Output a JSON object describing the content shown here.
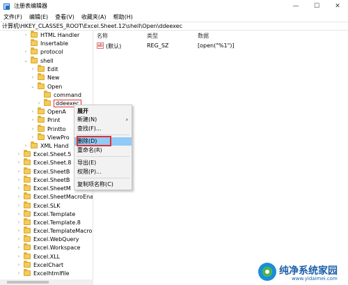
{
  "window": {
    "title": "注册表编辑器",
    "minimize": "—",
    "maximize": "☐",
    "close": "✕"
  },
  "menubar": [
    "文件(F)",
    "编辑(E)",
    "查看(V)",
    "收藏夹(A)",
    "帮助(H)"
  ],
  "address": "计算机\\HKEY_CLASSES_ROOT\\Excel.Sheet.12\\shell\\Open\\ddeexec",
  "tree": [
    {
      "label": "HTML Handler",
      "chevron": "›"
    },
    {
      "label": "Insertable",
      "chevron": ""
    },
    {
      "label": "protocol",
      "chevron": "›"
    },
    {
      "label": "shell",
      "chevron": "⌄"
    },
    {
      "label": "Edit",
      "chevron": "›"
    },
    {
      "label": "New",
      "chevron": "›"
    },
    {
      "label": "Open",
      "chevron": "⌄"
    },
    {
      "label": "command",
      "chevron": ""
    },
    {
      "label": "ddeexec",
      "chevron": "›"
    },
    {
      "label": "OpenA",
      "chevron": "›"
    },
    {
      "label": "Print",
      "chevron": "›"
    },
    {
      "label": "Printto",
      "chevron": "›"
    },
    {
      "label": "ViewPro",
      "chevron": "›"
    },
    {
      "label": "XML Hand",
      "chevron": "›"
    },
    {
      "label": "Excel.Sheet.5",
      "chevron": "›"
    },
    {
      "label": "Excel.Sheet.8",
      "chevron": "›"
    },
    {
      "label": "Excel.SheetB",
      "chevron": "›"
    },
    {
      "label": "Excel.SheetB",
      "chevron": "›"
    },
    {
      "label": "Excel.SheetM",
      "chevron": "›"
    },
    {
      "label": "Excel.SheetMacroEna",
      "chevron": "›"
    },
    {
      "label": "Excel.SLK",
      "chevron": "›"
    },
    {
      "label": "Excel.Template",
      "chevron": "›"
    },
    {
      "label": "Excel.Template.8",
      "chevron": "›"
    },
    {
      "label": "Excel.TemplateMacro",
      "chevron": "›"
    },
    {
      "label": "Excel.WebQuery",
      "chevron": "›"
    },
    {
      "label": "Excel.Workspace",
      "chevron": "›"
    },
    {
      "label": "Excel.XLL",
      "chevron": "›"
    },
    {
      "label": "ExcelChart",
      "chevron": "›"
    },
    {
      "label": "Excelhtmlfile",
      "chevron": "›"
    }
  ],
  "values": {
    "columns": [
      "名称",
      "类型",
      "数据"
    ],
    "rows": [
      {
        "icon": "ab",
        "name": "(默认)",
        "type": "REG_SZ",
        "data": "[open(\"%1\")]"
      }
    ]
  },
  "context_menu": {
    "items": [
      "展开",
      "新建(N)",
      "查找(F)...",
      "删除(D)",
      "重命名(R)",
      "导出(E)",
      "权限(P)...",
      "复制项名称(C)"
    ],
    "submenu_arrow": "›"
  },
  "watermark": {
    "text": "纯净系统家园",
    "url": "www.yidaimei.com"
  }
}
